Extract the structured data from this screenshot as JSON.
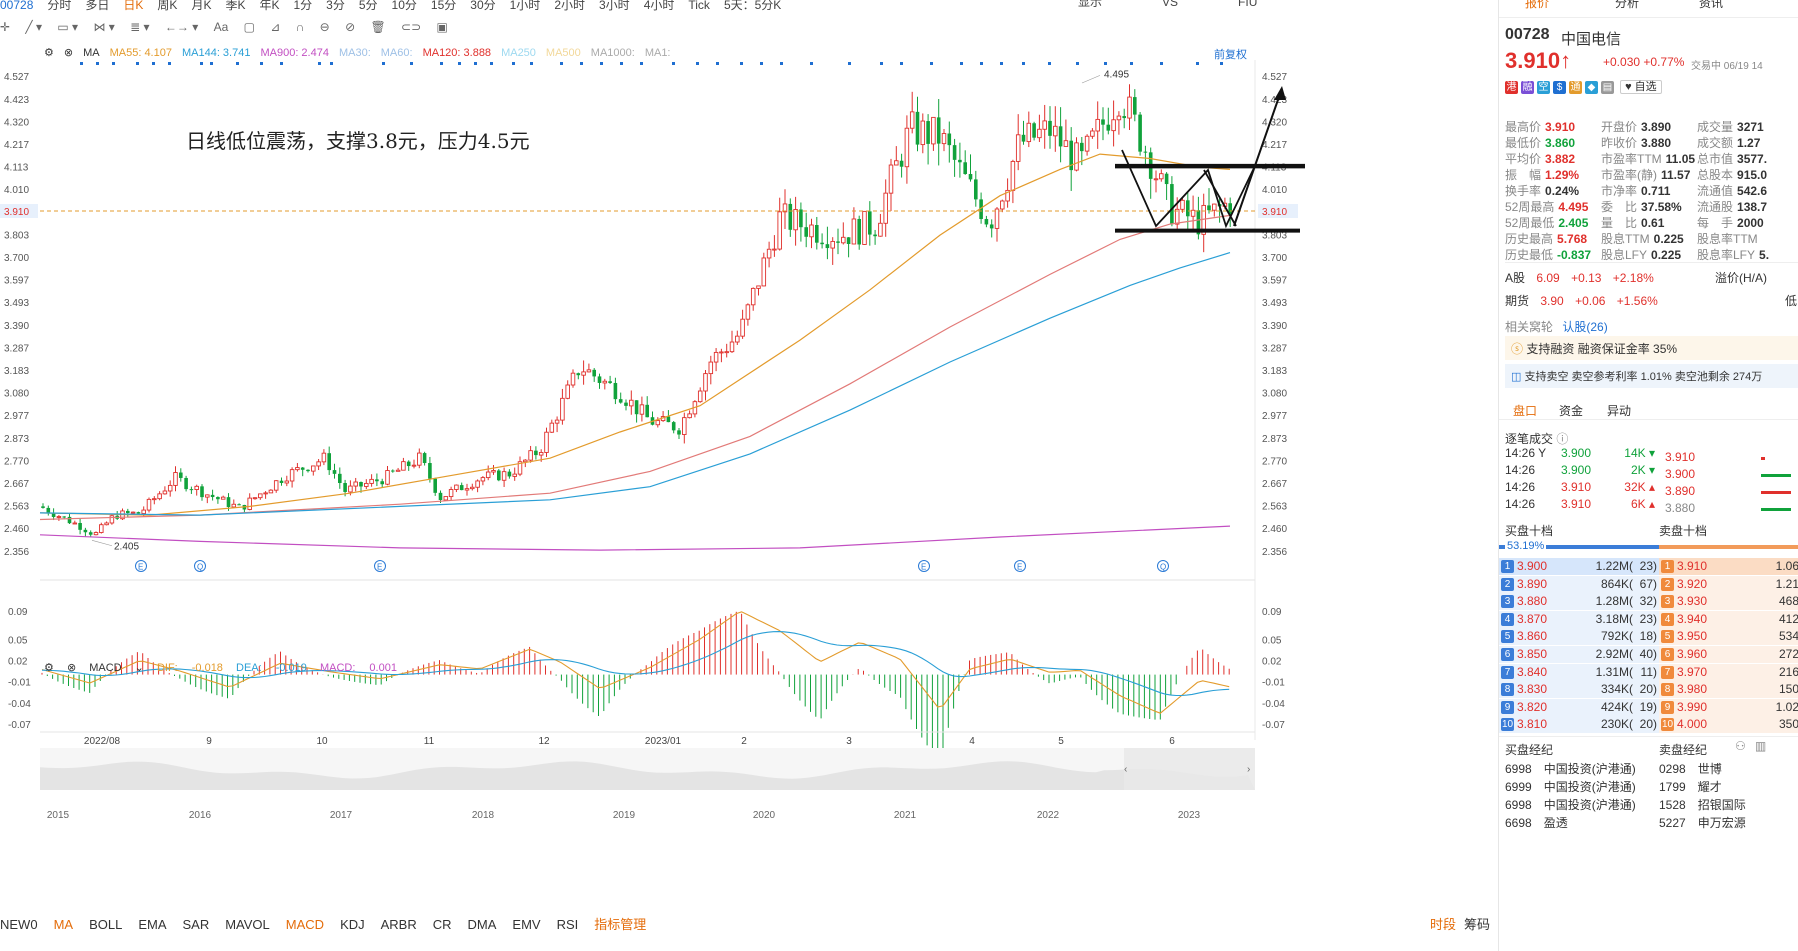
{
  "topbar": {
    "code": "00728",
    "periods": [
      "分时",
      "多日",
      "日K",
      "周K",
      "月K",
      "季K",
      "年K",
      "1分",
      "3分",
      "5分",
      "10分",
      "15分",
      "30分",
      "1小时",
      "2小时",
      "3小时",
      "4小时",
      "Tick",
      "5天：5分K"
    ],
    "active_period": "日K",
    "right_items": [
      "显示",
      "VS",
      "FIU"
    ]
  },
  "ma_legend": [
    {
      "label": "MA",
      "value": "",
      "color": "#333"
    },
    {
      "label": "MA55:",
      "value": "4.107",
      "color": "#e39b2c"
    },
    {
      "label": "MA144:",
      "value": "3.741",
      "color": "#2a9fd6"
    },
    {
      "label": "MA900:",
      "value": "2.474",
      "color": "#c24fc2"
    },
    {
      "label": "MA30:",
      "value": "",
      "color": "#9ec0e6"
    },
    {
      "label": "MA60:",
      "value": "",
      "color": "#9ec0e6"
    },
    {
      "label": "MA120:",
      "value": "3.888",
      "color": "#e0302c"
    },
    {
      "label": "MA250",
      "value": "",
      "color": "#9ed9f0"
    },
    {
      "label": "MA500",
      "value": "",
      "color": "#f2d89a"
    },
    {
      "label": "MA1000:",
      "value": "",
      "color": "#aaa"
    },
    {
      "label": "MA1:",
      "value": "",
      "color": "#aaa"
    }
  ],
  "fuquan_label": "前复权",
  "annotation": "日线低位震荡，支撑3.8元，压力4.5元",
  "price_axis": [
    "4.527",
    "4.423",
    "4.320",
    "4.217",
    "4.113",
    "4.010",
    "3.910",
    "3.803",
    "3.700",
    "3.597",
    "3.493",
    "3.390",
    "3.287",
    "3.183",
    "3.080",
    "2.977",
    "2.873",
    "2.770",
    "2.667",
    "2.563",
    "2.460",
    "2.356"
  ],
  "current_price_tag": "3.910",
  "high_label": "4.495",
  "low_label": "2.405",
  "macd_legend": {
    "name": "MACD",
    "dif_label": "DIF:",
    "dif": "-0.018",
    "dea_label": "DEA:",
    "dea": "-0.019",
    "macd_label": "MACD:",
    "macd": "0.001"
  },
  "macd_axis": [
    "0.09",
    "0.05",
    "0.02",
    "-0.01",
    "-0.04",
    "-0.07"
  ],
  "x_axis_labels": [
    "2022/08",
    "9",
    "10",
    "11",
    "12",
    "2023/01",
    "2",
    "3",
    "4",
    "5",
    "6"
  ],
  "overview_years": [
    "2015",
    "2016",
    "2017",
    "2018",
    "2019",
    "2020",
    "2021",
    "2022",
    "2023"
  ],
  "bottom_indicators": [
    "NEW0",
    "MA",
    "BOLL",
    "EMA",
    "SAR",
    "MAVOL",
    "MACD",
    "KDJ",
    "ARBR",
    "CR",
    "DMA",
    "EMV",
    "RSI",
    "指标管理"
  ],
  "bottom_active": [
    "MA",
    "MACD"
  ],
  "bottom_right": [
    "时段",
    "筹码"
  ],
  "chart_data": {
    "type": "candlestick",
    "title": "日线低位震荡，支撑3.8元，压力4.5元",
    "ylim": [
      2.356,
      4.527
    ],
    "x_range": [
      "2022/07",
      "2023/06"
    ],
    "key_levels": {
      "support": 3.8,
      "resistance": 4.5,
      "period_high": 4.495,
      "period_low": 2.405,
      "last": 3.91
    },
    "ma_latest": {
      "MA55": 4.107,
      "MA144": 3.741,
      "MA900": 2.474,
      "MA120": 3.888
    },
    "macd_latest": {
      "DIF": -0.018,
      "DEA": -0.019,
      "MACD": 0.001
    }
  },
  "panel": {
    "tabs": [
      "报价",
      "分析",
      "资讯"
    ],
    "code": "00728",
    "name": "中国电信",
    "price": "3.910",
    "change": "+0.030",
    "change_pct": "+0.77%",
    "status": "交易中 06/19 14",
    "watch": "自选",
    "stats": [
      [
        "最高价",
        "3.910",
        "开盘价",
        "3.890",
        "成交量",
        "3271"
      ],
      [
        "最低价",
        "3.860",
        "昨收价",
        "3.880",
        "成交额",
        "1.27"
      ],
      [
        "平均价",
        "3.882",
        "市盈率TTM",
        "11.05",
        "总市值",
        "3577."
      ],
      [
        "振　幅",
        "1.29%",
        "市盈率(静)",
        "11.57",
        "总股本",
        "915.0"
      ],
      [
        "换手率",
        "0.24%",
        "市净率",
        "0.711",
        "流通值",
        "542.6"
      ],
      [
        "52周最高",
        "4.495",
        "委　比",
        "37.58%",
        "流通股",
        "138.7"
      ],
      [
        "52周最低",
        "2.405",
        "量　比",
        "0.61",
        "每　手",
        "2000"
      ],
      [
        "历史最高",
        "5.768",
        "股息TTM",
        "0.225",
        "股息率TTM",
        ""
      ],
      [
        "历史最低",
        "-0.837",
        "股息LFY",
        "0.225",
        "股息率LFY",
        "5."
      ]
    ],
    "a_share": {
      "label": "A股",
      "price": "6.09",
      "chg": "+0.13",
      "pct": "+2.18%",
      "extra": "溢价(H/A)"
    },
    "futures": {
      "label": "期货",
      "price": "3.90",
      "chg": "+0.06",
      "pct": "+1.56%",
      "extra": "低"
    },
    "warrants": {
      "label": "相关窝轮",
      "link": "认股(26)"
    },
    "margin": "支持融资 融资保证金率 35%",
    "short": "支持卖空 卖空参考利率 1.01% 卖空池剩余 274万",
    "subtabs": [
      "盘口",
      "资金",
      "异动"
    ],
    "ticks_title": "逐笔成交",
    "ticks": [
      {
        "time": "14:26",
        "flag": "Y",
        "price": "3.900",
        "vol": "14K",
        "dir": "down"
      },
      {
        "time": "14:26",
        "flag": "",
        "price": "3.900",
        "vol": "2K",
        "dir": "down"
      },
      {
        "time": "14:26",
        "flag": "",
        "price": "3.910",
        "vol": "32K",
        "dir": "up"
      },
      {
        "time": "14:26",
        "flag": "",
        "price": "3.910",
        "vol": "6K",
        "dir": "up"
      }
    ],
    "tick_prices": [
      "3.910",
      "3.900",
      "3.890",
      "3.880"
    ],
    "buy_title": "买盘十档",
    "sell_title": "卖盘十档",
    "buy_ratio": "53.19%",
    "bids": [
      {
        "n": "1",
        "p": "3.900",
        "v": "1.22M(",
        "c": "23)"
      },
      {
        "n": "2",
        "p": "3.890",
        "v": "864K(",
        "c": "67)"
      },
      {
        "n": "3",
        "p": "3.880",
        "v": "1.28M(",
        "c": "32)"
      },
      {
        "n": "4",
        "p": "3.870",
        "v": "3.18M(",
        "c": "23)"
      },
      {
        "n": "5",
        "p": "3.860",
        "v": "792K(",
        "c": "18)"
      },
      {
        "n": "6",
        "p": "3.850",
        "v": "2.92M(",
        "c": "40)"
      },
      {
        "n": "7",
        "p": "3.840",
        "v": "1.31M(",
        "c": "11)"
      },
      {
        "n": "8",
        "p": "3.830",
        "v": "334K(",
        "c": "20)"
      },
      {
        "n": "9",
        "p": "3.820",
        "v": "424K(",
        "c": "19)"
      },
      {
        "n": "10",
        "p": "3.810",
        "v": "230K(",
        "c": "20)"
      }
    ],
    "asks": [
      {
        "n": "1",
        "p": "3.910",
        "v": "1.06"
      },
      {
        "n": "2",
        "p": "3.920",
        "v": "1.21"
      },
      {
        "n": "3",
        "p": "3.930",
        "v": "468"
      },
      {
        "n": "4",
        "p": "3.940",
        "v": "412"
      },
      {
        "n": "5",
        "p": "3.950",
        "v": "534"
      },
      {
        "n": "6",
        "p": "3.960",
        "v": "272"
      },
      {
        "n": "7",
        "p": "3.970",
        "v": "216"
      },
      {
        "n": "8",
        "p": "3.980",
        "v": "150"
      },
      {
        "n": "9",
        "p": "3.990",
        "v": "1.02"
      },
      {
        "n": "10",
        "p": "4.000",
        "v": "350"
      }
    ],
    "buy_brokers_title": "买盘经纪",
    "sell_brokers_title": "卖盘经纪",
    "buy_brokers": [
      {
        "id": "6998",
        "name": "中国投资(沪港通)"
      },
      {
        "id": "6999",
        "name": "中国投资(沪港通)"
      },
      {
        "id": "6998",
        "name": "中国投资(沪港通)"
      },
      {
        "id": "6698",
        "name": "盈透"
      }
    ],
    "sell_brokers": [
      {
        "id": "0298",
        "name": "世博"
      },
      {
        "id": "1799",
        "name": "耀才"
      },
      {
        "id": "1528",
        "name": "招银国际"
      },
      {
        "id": "5227",
        "name": "申万宏源"
      }
    ]
  }
}
